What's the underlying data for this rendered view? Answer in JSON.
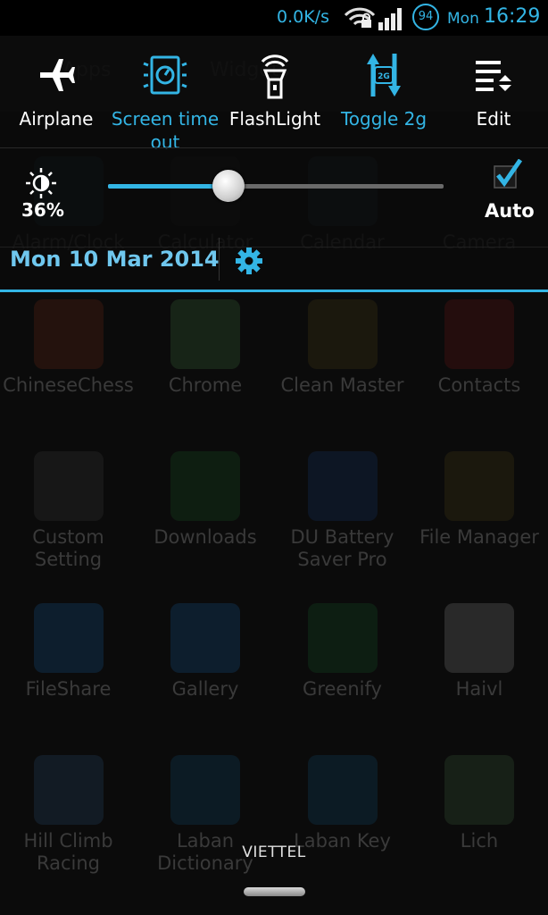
{
  "status_bar": {
    "net_speed": "0.0K/s",
    "battery": "94",
    "day": "Mon",
    "time": "16:29",
    "accent": "#33b5e5"
  },
  "toggles": [
    {
      "label": "Airplane",
      "icon": "airplane-icon",
      "active": false
    },
    {
      "label": "Screen time out",
      "icon": "screen-timeout-icon",
      "active": true
    },
    {
      "label": "FlashLight",
      "icon": "flashlight-icon",
      "active": false
    },
    {
      "label": "Toggle 2g",
      "icon": "toggle-2g-icon",
      "active": true
    },
    {
      "label": "Edit",
      "icon": "edit-icon",
      "active": false
    }
  ],
  "brightness": {
    "percent_label": "36%",
    "level": 0.36,
    "auto_label": "Auto",
    "auto_checked": true
  },
  "date_label": "Mon 10 Mar 2014",
  "carrier": "VIETTEL",
  "drawer": {
    "tabs": [
      "Apps",
      "Widgets"
    ],
    "apps": [
      [
        "Alarm/Clock",
        "Calculator",
        "Calendar",
        "Camera"
      ],
      [
        "ChineseChess",
        "Chrome",
        "Clean Master",
        "Contacts"
      ],
      [
        "Custom Setting",
        "Downloads",
        "DU Battery Saver Pro",
        "File Manager"
      ],
      [
        "FileShare",
        "Gallery",
        "Greenify",
        "Haivl"
      ],
      [
        "Hill Climb Racing",
        "Laban Dictionary",
        "Laban Key",
        "Lich"
      ]
    ]
  }
}
